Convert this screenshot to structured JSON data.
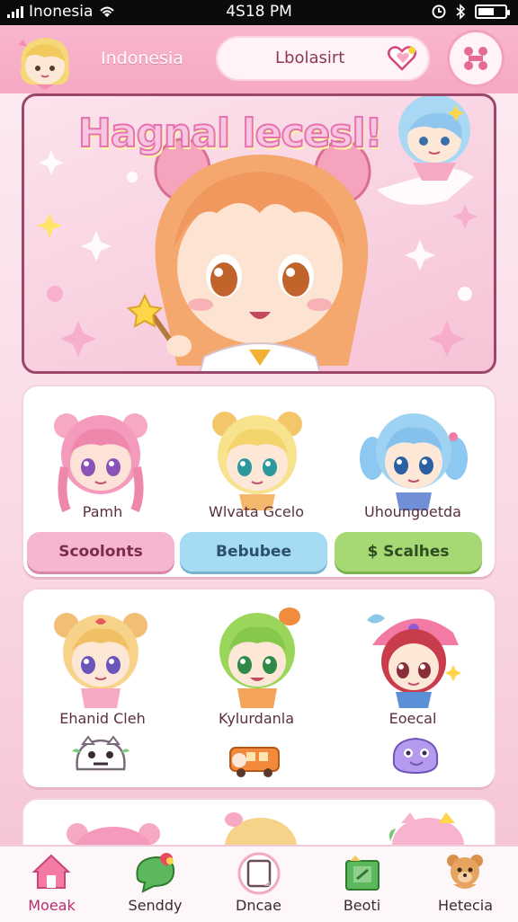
{
  "status_bar": {
    "carrier": "Inonesia",
    "time": "4S18 PM",
    "battery_level": 0.6
  },
  "header": {
    "region_label": "Indonesia",
    "search_text": "Lbolasirt"
  },
  "hero": {
    "title": "Hagnal lecesl!"
  },
  "card1": {
    "characters": [
      {
        "name": "Pamh"
      },
      {
        "name": "Wlvata Gcelo"
      },
      {
        "name": "Uhoungoetda"
      }
    ],
    "buttons": [
      {
        "label": "Scoolonts",
        "color": "#f7b6cf"
      },
      {
        "label": "Bebubee",
        "color": "#a6dcf3"
      },
      {
        "label": "$ Scalhes",
        "color": "#a6d873"
      }
    ]
  },
  "card2": {
    "characters": [
      {
        "name": "Ehanid Cleh"
      },
      {
        "name": "Kylurdanla"
      },
      {
        "name": "Eoecal"
      }
    ]
  },
  "bottom_nav": {
    "items": [
      {
        "label": "Moeak",
        "icon": "home-icon"
      },
      {
        "label": "Senddy",
        "icon": "chat-bubble-icon"
      },
      {
        "label": "Dncae",
        "icon": "card-icon"
      },
      {
        "label": "Beoti",
        "icon": "gift-box-icon"
      },
      {
        "label": "Hetecia",
        "icon": "teddy-bear-icon"
      }
    ]
  },
  "colors": {
    "brand_pink": "#f6a9c3",
    "accent_blue": "#a6dcf3",
    "accent_green": "#a6d873"
  }
}
